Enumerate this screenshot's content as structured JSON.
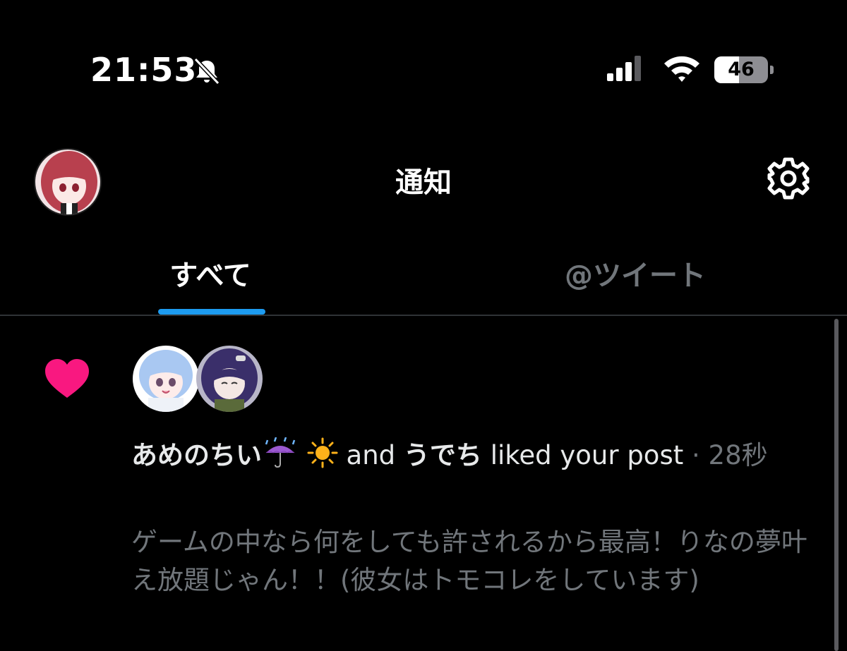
{
  "status_bar": {
    "time": "21:53",
    "battery": "46",
    "battery_level": 0.46,
    "silent_icon": "bell-slash-icon",
    "signal_icon": "cellular-signal-icon",
    "wifi_icon": "wifi-icon"
  },
  "header": {
    "title": "通知",
    "avatar_icon": "profile-avatar",
    "settings_icon": "gear-icon"
  },
  "tabs": [
    {
      "label": "すべて",
      "active": true
    },
    {
      "label": "@ツイート",
      "active": false
    }
  ],
  "notification": {
    "type_icon": "heart-icon",
    "user1": "あめのちい",
    "user2": "うでち",
    "joiner": "and",
    "action": "liked your post",
    "separator": "·",
    "time": "28秒",
    "post_text": "ゲームの中なら何をしても許されるから最高！りなの夢叶え放題じゃん！！(彼女はトモコレをしています)"
  },
  "colors": {
    "background": "#000000",
    "accent": "#1d9bf0",
    "like": "#f91880",
    "muted_text": "#71767b"
  }
}
